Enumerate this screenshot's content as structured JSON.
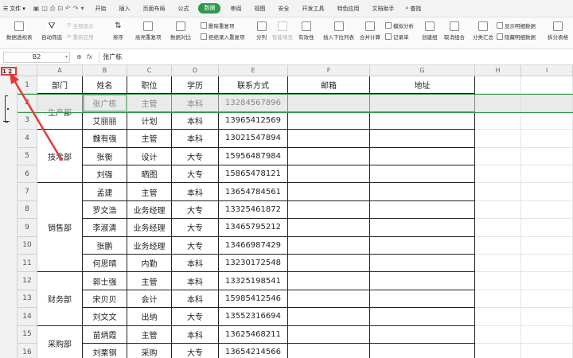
{
  "menubar": {
    "file_label": "文件",
    "tabs": [
      "开始",
      "插入",
      "页面布局",
      "公式",
      "数据",
      "审阅",
      "视图",
      "安全",
      "开发工具",
      "特色应用",
      "文档助手"
    ],
    "active_tab": "数据",
    "search_label": "查找"
  },
  "ribbon": {
    "pivot": "数据透视表",
    "autofilter": "自动筛选",
    "showall": "全部显示",
    "reapply": "重新应用",
    "sort": "排序",
    "highlight_dup": "高亮重复项",
    "compare": "数据对比",
    "delete_dup": "删除重复项",
    "reject_dup": "拒绝录入重复项",
    "split": "分列",
    "smartfill": "智能填充",
    "validity": "有效性",
    "dropdown": "插入下拉列表",
    "merge_calc": "合并计算",
    "simulate": "模拟分析",
    "record": "记录单",
    "group": "创建组",
    "ungroup": "取消组合",
    "subtotal": "分类汇总",
    "show_detail": "显示明细数据",
    "hide_detail": "隐藏明细数据",
    "split_table": "拆分表格"
  },
  "formula": {
    "cell_ref": "B2",
    "fx": "fx",
    "content": "张广栋"
  },
  "outline": {
    "levels": "1 2"
  },
  "columns": [
    "A",
    "B",
    "C",
    "D",
    "E",
    "F",
    "G",
    "H",
    "I"
  ],
  "rows": [
    "1",
    "2",
    "3",
    "4",
    "5",
    "6",
    "7",
    "8",
    "9",
    "10",
    "11",
    "12",
    "13",
    "14",
    "15",
    "16"
  ],
  "table": {
    "headers": [
      "部门",
      "姓名",
      "职位",
      "学历",
      "联系方式",
      "邮箱",
      "地址"
    ],
    "departments": [
      "生产部",
      "技术部",
      "销售部",
      "财务部",
      "采购部"
    ],
    "data": [
      [
        "张广栋",
        "主管",
        "本科",
        "13284567896"
      ],
      [
        "艾丽丽",
        "计划",
        "本科",
        "13965412569"
      ],
      [
        "魏有强",
        "主管",
        "本科",
        "13021547894"
      ],
      [
        "张衡",
        "设计",
        "大专",
        "15956487984"
      ],
      [
        "刘强",
        "晒图",
        "大专",
        "15865478121"
      ],
      [
        "孟建",
        "主管",
        "本科",
        "13654784561"
      ],
      [
        "罗文浩",
        "业务经理",
        "大专",
        "13325461872"
      ],
      [
        "李淑清",
        "业务经理",
        "大专",
        "13465795212"
      ],
      [
        "张鹏",
        "业务经理",
        "大专",
        "13466987429"
      ],
      [
        "何思晴",
        "内勤",
        "本科",
        "13230172548"
      ],
      [
        "郭士强",
        "主管",
        "本科",
        "13325198541"
      ],
      [
        "宋贝贝",
        "会计",
        "本科",
        "15985412546"
      ],
      [
        "刘文文",
        "出纳",
        "大专",
        "13552316694"
      ],
      [
        "苗炳霞",
        "主管",
        "本科",
        "13625468211"
      ],
      [
        "刘栗钢",
        "采购",
        "大专",
        "13654214566"
      ]
    ]
  }
}
